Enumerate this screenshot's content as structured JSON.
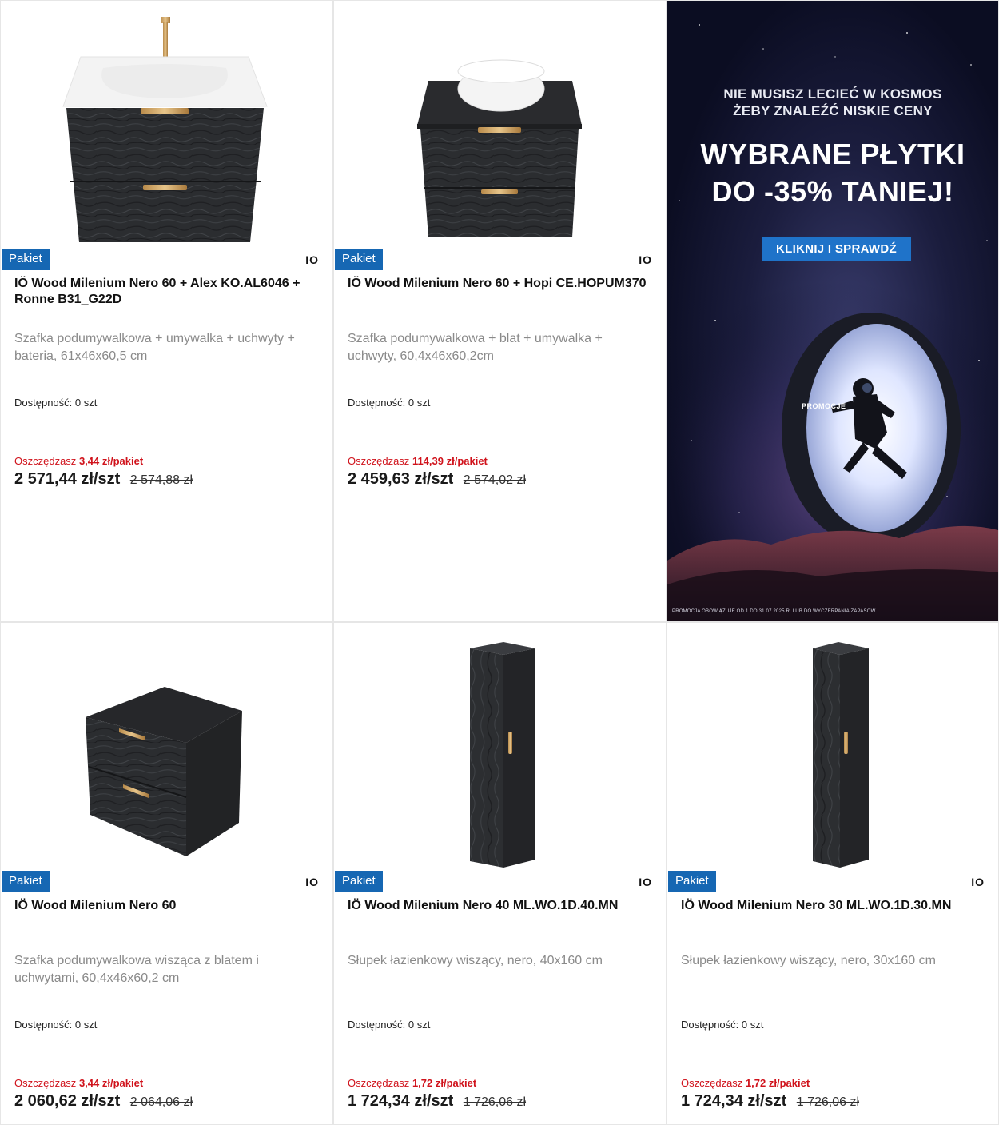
{
  "banner": {
    "subheadline": "NIE MUSISZ LECIEĆ W KOSMOS\nŻEBY ZNALEŹĆ NISKIE CENY",
    "headline": "WYBRANE PŁYTKI\nDO -35% TANIEJ!",
    "button": "KLIKNIJ I SPRAWDŹ",
    "tag": "PROMOCJE",
    "footnote": "PROMOCJA OBOWIĄZUJE OD 1 DO 31.07.2025 R. LUB DO WYCZERPANIA ZAPASÓW."
  },
  "products": [
    {
      "badge": "Pakiet",
      "brand": "IO",
      "title": "IÖ Wood Milenium Nero 60 + Alex KO.AL6046 + Ronne B31_G22D",
      "description": "Szafka podumywalkowa + umywalka + uchwyty + bateria, 61x46x60,5 cm",
      "availability": "Dostępność: 0 szt",
      "savings_label": "Oszczędzasz",
      "savings_value": "3,44 zł/pakiet",
      "price": "2 571,44 zł/szt",
      "old_price": "2 574,88 zł"
    },
    {
      "badge": "Pakiet",
      "brand": "IO",
      "title": "IÖ Wood Milenium Nero 60 + Hopi CE.HOPUM370",
      "description": "Szafka podumywalkowa + blat + umywalka + uchwyty, 60,4x46x60,2cm",
      "availability": "Dostępność: 0 szt",
      "savings_label": "Oszczędzasz",
      "savings_value": "114,39 zł/pakiet",
      "price": "2 459,63 zł/szt",
      "old_price": "2 574,02 zł"
    },
    {
      "badge": "Pakiet",
      "brand": "IO",
      "title": "IÖ Wood Milenium Nero 60",
      "description": "Szafka podumywalkowa wisząca z blatem i uchwytami, 60,4x46x60,2 cm",
      "availability": "Dostępność: 0 szt",
      "savings_label": "Oszczędzasz",
      "savings_value": "3,44 zł/pakiet",
      "price": "2 060,62 zł/szt",
      "old_price": "2 064,06 zł"
    },
    {
      "badge": "Pakiet",
      "brand": "IO",
      "title": "IÖ Wood Milenium Nero 40 ML.WO.1D.40.MN",
      "description": "Słupek łazienkowy wiszący, nero, 40x160 cm",
      "availability": "Dostępność: 0 szt",
      "savings_label": "Oszczędzasz",
      "savings_value": "1,72 zł/pakiet",
      "price": "1 724,34 zł/szt",
      "old_price": "1 726,06 zł"
    },
    {
      "badge": "Pakiet",
      "brand": "IO",
      "title": "IÖ Wood Milenium Nero 30 ML.WO.1D.30.MN",
      "description": "Słupek łazienkowy wiszący, nero, 30x160 cm",
      "availability": "Dostępność: 0 szt",
      "savings_label": "Oszczędzasz",
      "savings_value": "1,72 zł/pakiet",
      "price": "1 724,34 zł/szt",
      "old_price": "1 726,06 zł"
    }
  ]
}
